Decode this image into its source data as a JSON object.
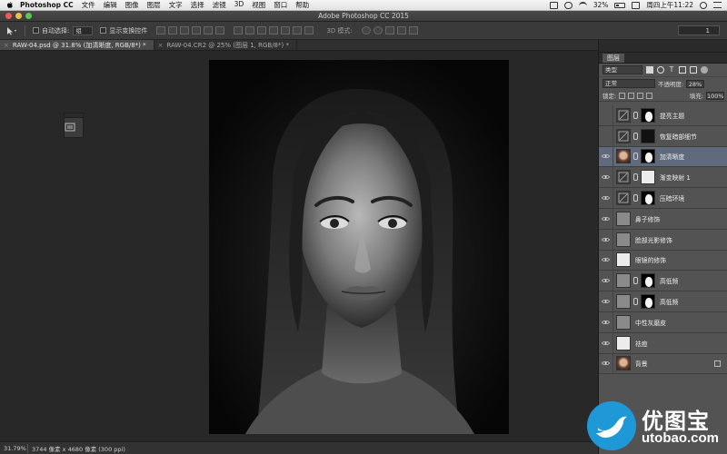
{
  "menubar": {
    "app_name": "Photoshop CC",
    "menus": [
      "文件",
      "编辑",
      "图像",
      "图层",
      "文字",
      "选择",
      "滤镜",
      "3D",
      "视图",
      "窗口",
      "帮助"
    ],
    "battery": "32%",
    "clock": "周四上午11:22"
  },
  "window": {
    "title": "Adobe Photoshop CC 2015"
  },
  "options": {
    "auto_select_label": "自动选择:",
    "auto_select_value": "组",
    "show_transform_label": "显示变换控件",
    "mode_3d_label": "3D 模式:",
    "right_field_value": "1"
  },
  "tabs": [
    {
      "label": "RAW-04.psd @ 31.8% (加清晰度, RGB/8*) *",
      "active": true
    },
    {
      "label": "RAW-04.CR2 @ 25% (图层 1, RGB/8*) *",
      "active": false
    }
  ],
  "status": {
    "zoom": "31.79%",
    "doc_info": "3744 像素 x 4680 像素 (300 ppi)"
  },
  "layers_panel": {
    "tab_label": "图层",
    "filter_kind": "类型",
    "blend_mode": "正常",
    "opacity_label": "不透明度:",
    "opacity_value": "28%",
    "lock_label": "锁定:",
    "fill_label": "填充:",
    "fill_value": "100%",
    "layers": [
      {
        "name": "提亮主题",
        "visible": false,
        "thumb": "adj",
        "mask": "mask",
        "selected": false
      },
      {
        "name": "恢复暗部细节",
        "visible": false,
        "thumb": "adj",
        "mask": "black",
        "selected": false
      },
      {
        "name": "加清晰度",
        "visible": true,
        "thumb": "face",
        "mask": "mask",
        "selected": true
      },
      {
        "name": "渐变映射 1",
        "visible": true,
        "thumb": "adj",
        "mask": "white",
        "selected": false
      },
      {
        "name": "压暗环境",
        "visible": true,
        "thumb": "adj",
        "mask": "mask",
        "selected": false
      },
      {
        "name": "鼻子修饰",
        "visible": true,
        "thumb": "gray",
        "mask": "",
        "selected": false
      },
      {
        "name": "脸部光影修饰",
        "visible": true,
        "thumb": "gray",
        "mask": "",
        "selected": false
      },
      {
        "name": "眼镜的修饰",
        "visible": true,
        "thumb": "white",
        "mask": "",
        "selected": false
      },
      {
        "name": "高低频",
        "visible": true,
        "thumb": "gray",
        "mask": "mask",
        "selected": false
      },
      {
        "name": "高低频",
        "visible": true,
        "thumb": "gray",
        "mask": "mask",
        "selected": false
      },
      {
        "name": "中性灰磨皮",
        "visible": true,
        "thumb": "gray",
        "mask": "",
        "selected": false
      },
      {
        "name": "祛痘",
        "visible": true,
        "thumb": "white",
        "mask": "",
        "selected": false
      },
      {
        "name": "背景",
        "visible": true,
        "thumb": "face",
        "mask": "",
        "selected": false,
        "locked": true
      }
    ]
  },
  "watermark": {
    "name": "优图宝",
    "url": "utobao.com"
  },
  "icons": [
    "apple-icon",
    "move-tool-icon",
    "eye-icon",
    "lock-icon",
    "link-icon"
  ]
}
